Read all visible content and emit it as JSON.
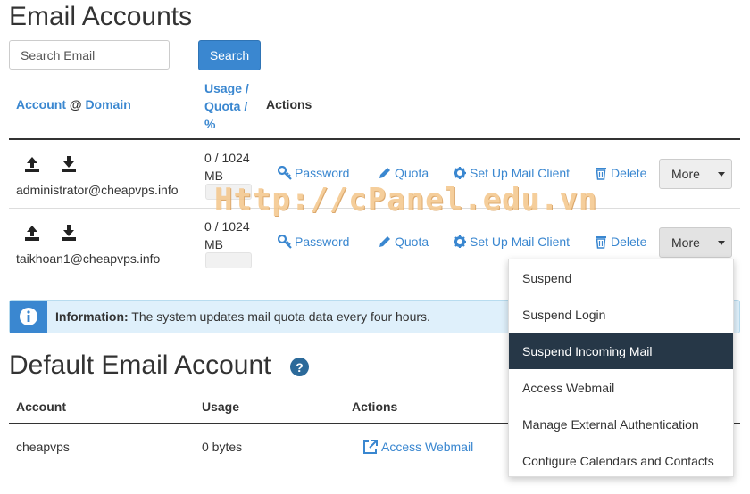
{
  "page_title": "Email Accounts",
  "search": {
    "placeholder": "Search Email",
    "button_label": "Search"
  },
  "table_headers": {
    "account": "Account",
    "at": "@",
    "domain": "Domain",
    "usage": "Usage /",
    "quota": "Quota /",
    "percent": "%",
    "actions": "Actions"
  },
  "accounts": [
    {
      "email": "administrator@cheapvps.info",
      "usage_line1": "0 / 1024",
      "usage_line2": "MB"
    },
    {
      "email": "taikhoan1@cheapvps.info",
      "usage_line1": "0 / 1024",
      "usage_line2": "MB"
    }
  ],
  "row_actions": {
    "password": "Password",
    "quota": "Quota",
    "setup_client": "Set Up Mail Client",
    "delete": "Delete",
    "more": "More"
  },
  "info": {
    "label": "Information:",
    "text": "The system updates mail quota data every four hours."
  },
  "default_section": {
    "title": "Default Email Account",
    "help_icon": "question-circle-icon",
    "headers": {
      "account": "Account",
      "usage": "Usage",
      "actions": "Actions"
    },
    "row": {
      "account": "cheapvps",
      "usage": "0 bytes",
      "action": "Access Webmail"
    }
  },
  "more_menu": {
    "items": [
      "Suspend",
      "Suspend Login",
      "Suspend Incoming Mail",
      "Access Webmail",
      "Manage External Authentication",
      "Configure Calendars and Contacts"
    ],
    "active_index": 2
  },
  "watermark": "Http://cPanel.edu.vn",
  "colors": {
    "link": "#3a87d0",
    "active_menu_bg": "#263747",
    "info_bg": "#dff0fb"
  }
}
